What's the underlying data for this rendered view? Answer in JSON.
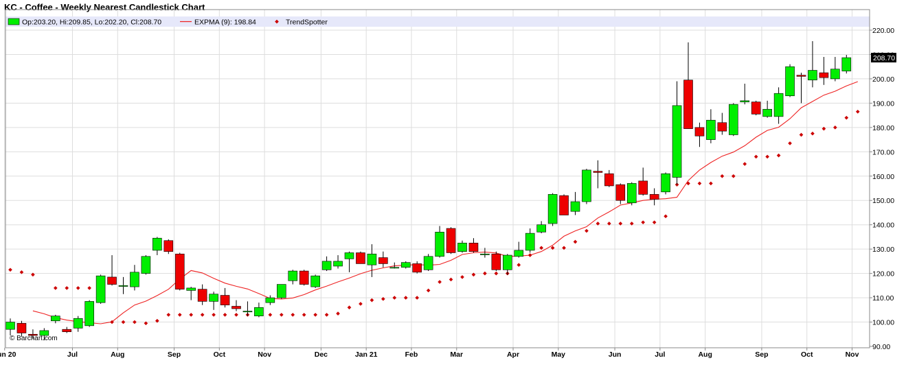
{
  "title": "KC - Coffee - Weekly Nearest Candlestick Chart",
  "legend": {
    "ohlc": "Op:203.20, Hi:209.85, Lo:202.20, Cl:208.70",
    "expma": "EXPMA (9): 198.84",
    "trendspotter": "TrendSpotter"
  },
  "copyright": "© Barchart.com",
  "last_price_label": "208.70",
  "colors": {
    "up": "#00ee00",
    "down": "#ee0000",
    "expma": "#ee2222",
    "trendspotter": "#cc0000",
    "legend_bg": "#e6e8fa",
    "grid": "#dddddd"
  },
  "chart_data": {
    "type": "candlestick",
    "title": "KC - Coffee - Weekly Nearest Candlestick Chart",
    "ylim": [
      90,
      220
    ],
    "y_ticks": [
      "90.00",
      "100.00",
      "110.00",
      "120.00",
      "130.00",
      "140.00",
      "150.00",
      "160.00",
      "170.00",
      "180.00",
      "190.00",
      "200.00",
      "210.00",
      "220.00"
    ],
    "y_tick_values": [
      90,
      100,
      110,
      120,
      130,
      140,
      150,
      160,
      170,
      180,
      190,
      200,
      210,
      220
    ],
    "x_ticks": [
      {
        "label": "Jun 20",
        "index": -0.5
      },
      {
        "label": "Jul",
        "index": 5.5
      },
      {
        "label": "Aug",
        "index": 9.5
      },
      {
        "label": "Sep",
        "index": 14.5
      },
      {
        "label": "Oct",
        "index": 18.5
      },
      {
        "label": "Nov",
        "index": 22.5
      },
      {
        "label": "Dec",
        "index": 27.5
      },
      {
        "label": "Jan 21",
        "index": 31.5
      },
      {
        "label": "Feb",
        "index": 35.5
      },
      {
        "label": "Mar",
        "index": 39.5
      },
      {
        "label": "Apr",
        "index": 44.5
      },
      {
        "label": "May",
        "index": 48.5
      },
      {
        "label": "Jun",
        "index": 53.5
      },
      {
        "label": "Jul",
        "index": 57.5
      },
      {
        "label": "Aug",
        "index": 61.5
      },
      {
        "label": "Sep",
        "index": 66.5
      },
      {
        "label": "Oct",
        "index": 70.5
      },
      {
        "label": "Nov",
        "index": 74.5
      }
    ],
    "candles": [
      {
        "o": 97.0,
        "h": 101.5,
        "l": 94.5,
        "c": 100.0
      },
      {
        "o": 99.5,
        "h": 100.5,
        "l": 94.0,
        "c": 95.5
      },
      {
        "o": 95.0,
        "h": 97.0,
        "l": 93.0,
        "c": 94.5
      },
      {
        "o": 94.5,
        "h": 97.5,
        "l": 92.5,
        "c": 96.5
      },
      {
        "o": 100.5,
        "h": 103.0,
        "l": 99.5,
        "c": 102.5
      },
      {
        "o": 97.0,
        "h": 98.0,
        "l": 95.5,
        "c": 96.0
      },
      {
        "o": 97.5,
        "h": 102.5,
        "l": 96.0,
        "c": 101.5
      },
      {
        "o": 98.5,
        "h": 109.0,
        "l": 98.0,
        "c": 108.5
      },
      {
        "o": 108.0,
        "h": 119.5,
        "l": 107.5,
        "c": 119.0
      },
      {
        "o": 118.5,
        "h": 127.5,
        "l": 115.0,
        "c": 115.5
      },
      {
        "o": 115.0,
        "h": 118.5,
        "l": 111.5,
        "c": 115.0
      },
      {
        "o": 114.5,
        "h": 123.5,
        "l": 113.0,
        "c": 120.5
      },
      {
        "o": 120.0,
        "h": 127.5,
        "l": 119.5,
        "c": 127.0
      },
      {
        "o": 129.5,
        "h": 135.0,
        "l": 127.5,
        "c": 134.5
      },
      {
        "o": 133.5,
        "h": 134.0,
        "l": 128.0,
        "c": 129.0
      },
      {
        "o": 128.0,
        "h": 128.5,
        "l": 113.0,
        "c": 113.5
      },
      {
        "o": 113.0,
        "h": 114.5,
        "l": 109.0,
        "c": 114.0
      },
      {
        "o": 113.5,
        "h": 115.5,
        "l": 107.0,
        "c": 108.5
      },
      {
        "o": 108.5,
        "h": 112.5,
        "l": 105.0,
        "c": 111.5
      },
      {
        "o": 111.0,
        "h": 114.0,
        "l": 106.0,
        "c": 107.0
      },
      {
        "o": 106.5,
        "h": 109.0,
        "l": 104.5,
        "c": 105.5
      },
      {
        "o": 104.5,
        "h": 108.5,
        "l": 102.5,
        "c": 104.5
      },
      {
        "o": 102.5,
        "h": 108.0,
        "l": 102.0,
        "c": 106.0
      },
      {
        "o": 108.0,
        "h": 111.0,
        "l": 107.0,
        "c": 110.0
      },
      {
        "o": 110.0,
        "h": 115.5,
        "l": 109.5,
        "c": 115.5
      },
      {
        "o": 117.0,
        "h": 121.5,
        "l": 115.5,
        "c": 121.0
      },
      {
        "o": 121.0,
        "h": 121.5,
        "l": 115.0,
        "c": 115.5
      },
      {
        "o": 114.5,
        "h": 119.5,
        "l": 114.0,
        "c": 119.0
      },
      {
        "o": 121.5,
        "h": 127.0,
        "l": 121.0,
        "c": 125.0
      },
      {
        "o": 123.0,
        "h": 127.5,
        "l": 122.0,
        "c": 125.0
      },
      {
        "o": 126.0,
        "h": 129.0,
        "l": 120.5,
        "c": 128.5
      },
      {
        "o": 128.5,
        "h": 129.0,
        "l": 124.0,
        "c": 124.0
      },
      {
        "o": 123.5,
        "h": 132.0,
        "l": 118.5,
        "c": 128.0
      },
      {
        "o": 126.5,
        "h": 129.0,
        "l": 122.5,
        "c": 124.0
      },
      {
        "o": 122.5,
        "h": 124.5,
        "l": 122.0,
        "c": 122.5
      },
      {
        "o": 122.5,
        "h": 125.0,
        "l": 122.0,
        "c": 124.5
      },
      {
        "o": 124.0,
        "h": 125.0,
        "l": 120.0,
        "c": 120.5
      },
      {
        "o": 121.5,
        "h": 128.0,
        "l": 121.0,
        "c": 127.0
      },
      {
        "o": 127.0,
        "h": 139.5,
        "l": 126.5,
        "c": 137.0
      },
      {
        "o": 138.5,
        "h": 139.0,
        "l": 128.0,
        "c": 128.5
      },
      {
        "o": 129.0,
        "h": 133.5,
        "l": 128.5,
        "c": 132.5
      },
      {
        "o": 132.5,
        "h": 134.5,
        "l": 128.5,
        "c": 129.0
      },
      {
        "o": 128.0,
        "h": 130.5,
        "l": 126.5,
        "c": 128.0
      },
      {
        "o": 128.0,
        "h": 129.0,
        "l": 121.0,
        "c": 121.5
      },
      {
        "o": 121.5,
        "h": 128.0,
        "l": 119.5,
        "c": 127.5
      },
      {
        "o": 127.0,
        "h": 133.0,
        "l": 126.5,
        "c": 129.5
      },
      {
        "o": 129.5,
        "h": 138.5,
        "l": 128.5,
        "c": 136.5
      },
      {
        "o": 137.0,
        "h": 141.5,
        "l": 136.5,
        "c": 140.0
      },
      {
        "o": 140.5,
        "h": 153.0,
        "l": 139.5,
        "c": 152.5
      },
      {
        "o": 152.0,
        "h": 152.5,
        "l": 144.0,
        "c": 144.0
      },
      {
        "o": 145.5,
        "h": 153.5,
        "l": 144.0,
        "c": 149.5
      },
      {
        "o": 149.5,
        "h": 163.0,
        "l": 148.5,
        "c": 162.5
      },
      {
        "o": 162.0,
        "h": 166.5,
        "l": 155.0,
        "c": 161.5
      },
      {
        "o": 161.0,
        "h": 162.5,
        "l": 155.5,
        "c": 156.0
      },
      {
        "o": 156.5,
        "h": 157.0,
        "l": 148.5,
        "c": 150.0
      },
      {
        "o": 149.0,
        "h": 157.5,
        "l": 148.0,
        "c": 157.0
      },
      {
        "o": 158.0,
        "h": 163.5,
        "l": 152.0,
        "c": 152.5
      },
      {
        "o": 152.5,
        "h": 155.0,
        "l": 148.0,
        "c": 150.5
      },
      {
        "o": 153.5,
        "h": 161.5,
        "l": 152.5,
        "c": 161.0
      },
      {
        "o": 159.5,
        "h": 199.0,
        "l": 156.5,
        "c": 189.0
      },
      {
        "o": 199.5,
        "h": 215.0,
        "l": 179.5,
        "c": 179.5
      },
      {
        "o": 180.0,
        "h": 182.0,
        "l": 172.0,
        "c": 176.5
      },
      {
        "o": 175.0,
        "h": 187.5,
        "l": 173.5,
        "c": 183.0
      },
      {
        "o": 182.0,
        "h": 186.0,
        "l": 177.0,
        "c": 178.5
      },
      {
        "o": 177.0,
        "h": 190.0,
        "l": 176.5,
        "c": 189.5
      },
      {
        "o": 190.5,
        "h": 198.0,
        "l": 189.5,
        "c": 191.0
      },
      {
        "o": 190.5,
        "h": 191.0,
        "l": 185.0,
        "c": 185.5
      },
      {
        "o": 184.5,
        "h": 191.0,
        "l": 184.0,
        "c": 187.5
      },
      {
        "o": 184.5,
        "h": 196.5,
        "l": 181.5,
        "c": 194.0
      },
      {
        "o": 193.0,
        "h": 206.0,
        "l": 192.5,
        "c": 205.0
      },
      {
        "o": 201.5,
        "h": 202.5,
        "l": 190.0,
        "c": 201.0
      },
      {
        "o": 199.5,
        "h": 215.5,
        "l": 196.5,
        "c": 203.5
      },
      {
        "o": 202.5,
        "h": 209.0,
        "l": 197.5,
        "c": 200.5
      },
      {
        "o": 200.0,
        "h": 209.0,
        "l": 199.0,
        "c": 204.0
      },
      {
        "o": 203.2,
        "h": 209.85,
        "l": 202.2,
        "c": 208.7
      }
    ],
    "expma": [
      104.6,
      103.4,
      101.8,
      100.8,
      100.2,
      99.7,
      99.3,
      100.1,
      103.8,
      107.0,
      108.6,
      110.9,
      113.5,
      117.7,
      121.2,
      120.2,
      118.0,
      116.0,
      114.7,
      113.6,
      111.7,
      109.7,
      109.5,
      109.9,
      111.3,
      113.2,
      114.8,
      116.5,
      118.1,
      119.9,
      121.3,
      122.3,
      123.1,
      123.4,
      123.6,
      123.4,
      123.7,
      125.4,
      127.8,
      128.5,
      128.8,
      128.4,
      127.0,
      127.1,
      127.5,
      129.0,
      131.6,
      135.3,
      137.5,
      139.2,
      142.8,
      145.3,
      148.1,
      149.0,
      150.0,
      150.5,
      150.7,
      151.3,
      158.2,
      162.5,
      165.6,
      168.2,
      169.9,
      172.5,
      176.0,
      178.8,
      180.1,
      183.6,
      188.1,
      190.7,
      193.3,
      194.9,
      197.1,
      198.84
    ],
    "trendspotter": [
      121.5,
      120.5,
      119.5,
      null,
      114.0,
      114.0,
      114.0,
      114.0,
      null,
      100.0,
      100.0,
      100.0,
      99.5,
      100.5,
      103.0,
      103.0,
      103.0,
      103.0,
      103.0,
      103.0,
      103.0,
      103.0,
      103.0,
      103.0,
      103.0,
      103.0,
      103.0,
      103.0,
      103.0,
      103.5,
      106.0,
      107.5,
      109.0,
      109.5,
      110.0,
      110.0,
      110.0,
      113.0,
      116.5,
      117.5,
      118.5,
      119.5,
      120.0,
      120.0,
      120.0,
      123.5,
      127.5,
      130.5,
      130.5,
      130.5,
      133.0,
      137.5,
      140.5,
      140.5,
      140.5,
      140.5,
      141.0,
      141.0,
      143.5,
      156.5,
      157.0,
      157.0,
      157.0,
      160.0,
      160.0,
      165.0,
      168.0,
      168.0,
      168.5,
      173.5,
      177.0,
      177.5,
      179.5,
      180.0,
      184.0,
      186.5
    ]
  }
}
